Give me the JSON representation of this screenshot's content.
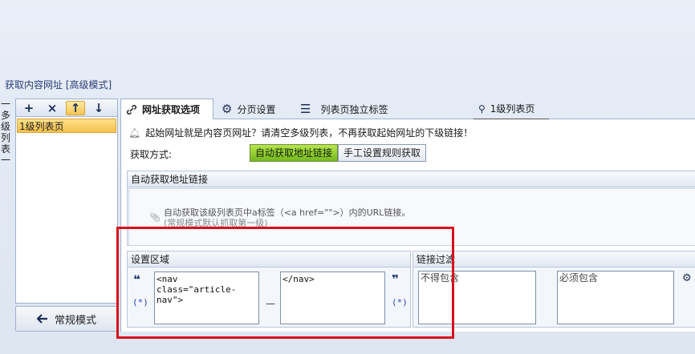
{
  "section_title": "获取内容网址 [高级模式]",
  "side_vertical_label": "一多级列表一",
  "left_panel": {
    "toolbar": {
      "add": "+",
      "delete": "×",
      "up": "↑",
      "down": "↓"
    },
    "items": [
      {
        "label": "1级列表页"
      }
    ],
    "mode_button": "常规模式"
  },
  "tabs": [
    {
      "label": "网址获取选项"
    },
    {
      "label": "分页设置"
    },
    {
      "label": "列表页独立标签"
    },
    {
      "label": "1级列表页"
    }
  ],
  "info_text": "起始网址就是内容页网址？请清空多级列表，不再获取起始网址的下级链接！",
  "method": {
    "label": "获取方式:",
    "options": [
      {
        "label": "自动获取地址链接"
      },
      {
        "label": "手工设置规则获取"
      }
    ]
  },
  "auto_group": {
    "title": "自动获取地址链接",
    "hint_line1": "自动获取该级列表页中a标签（<a href=\"\">）内的URL链接。",
    "hint_line2": "(常规模式默认抓取第一级)"
  },
  "settings_group": {
    "title": "设置区域",
    "open_quote": "❝",
    "close_quote": "❞",
    "regex_left": "(*)",
    "regex_right": "(*)",
    "start_value": "<nav class=\"article-nav\">",
    "end_value": "</nav>",
    "separator": "—"
  },
  "filter_group": {
    "title": "链接过滤",
    "exclude_placeholder": "不得包含",
    "include_placeholder": "必须包含"
  },
  "colors": {
    "accent": "#76b81f",
    "highlight": "#f5c24c",
    "annotation": "#d80f1f"
  }
}
